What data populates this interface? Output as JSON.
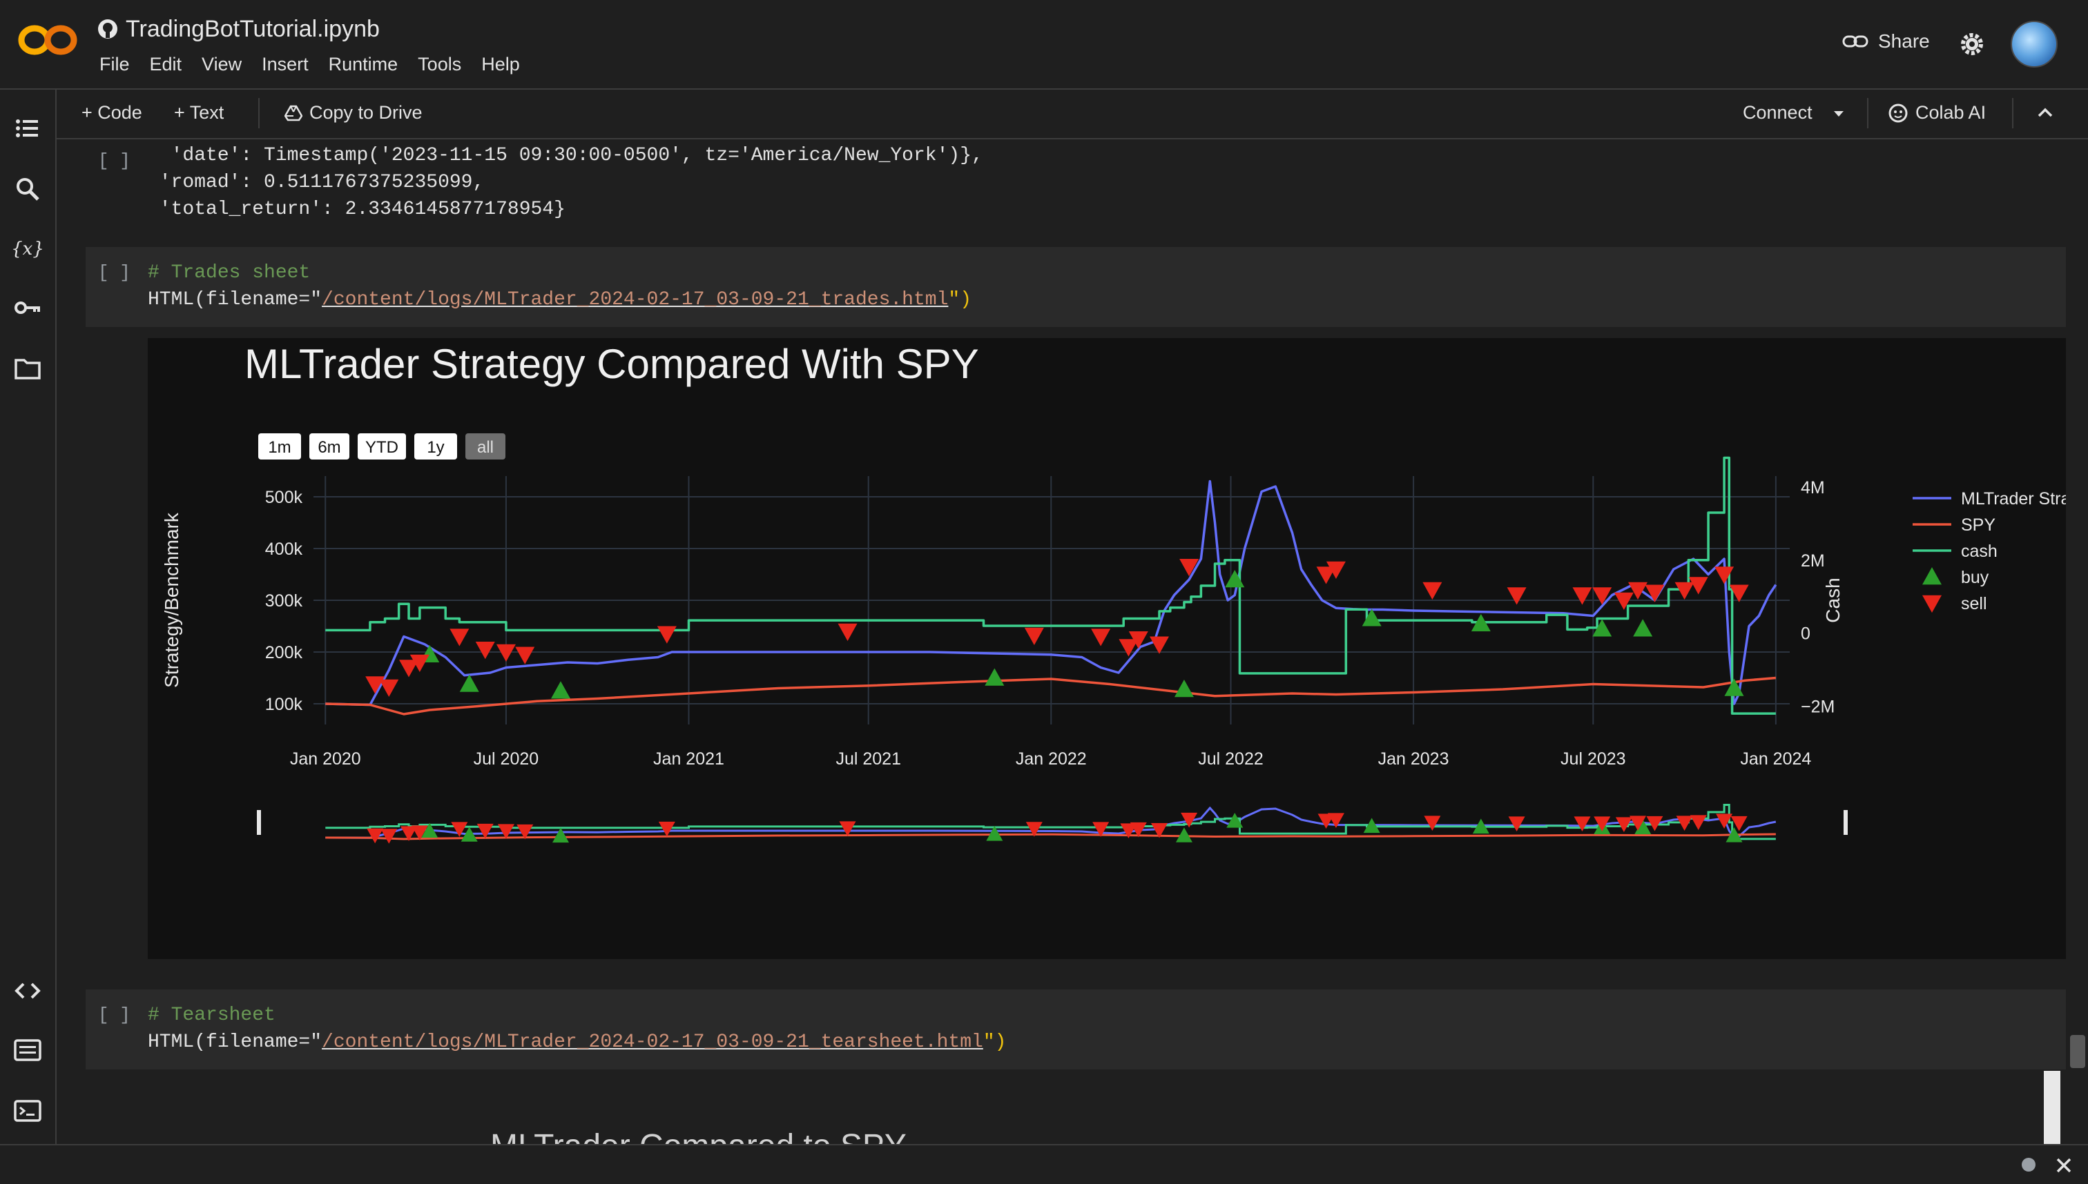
{
  "app": {
    "notebook_title": "TradingBotTutorial.ipynb",
    "menu": [
      "File",
      "Edit",
      "View",
      "Insert",
      "Runtime",
      "Tools",
      "Help"
    ],
    "share_label": "Share"
  },
  "toolbar": {
    "code_label": "+ Code",
    "text_label": "+ Text",
    "copy_label": "Copy to Drive",
    "connect_label": "Connect",
    "colab_ai_label": "Colab AI"
  },
  "cells": {
    "output_prev": {
      "bracket": "[ ]",
      "lines": [
        "  'date': Timestamp('2023-11-15 09:30:00-0500', tz='America/New_York')},",
        " 'romad': 0.5111767375235099,",
        " 'total_return': 2.3346145877178954}"
      ]
    },
    "trades_cell": {
      "bracket": "[ ]",
      "comment": "# Trades sheet",
      "code_prefix": "HTML(filename=\"",
      "code_path": "/content/logs/MLTrader_2024-02-17_03-09-21_trades.html",
      "code_suffix": "\")"
    },
    "tearsheet_cell": {
      "bracket": "[ ]",
      "comment": "# Tearsheet",
      "code_prefix": "HTML(filename=\"",
      "code_path": "/content/logs/MLTrader_2024-02-17_03-09-21_tearsheet.html",
      "code_suffix": "\")"
    },
    "partial_title": "MLTrader Compared to SPY"
  },
  "chart_data": {
    "type": "line",
    "title": "MLTrader Strategy Compared With SPY",
    "range_buttons": [
      "1m",
      "6m",
      "YTD",
      "1y",
      "all"
    ],
    "range_selected": "all",
    "ylabel": "Strategy/Benchmark",
    "y2label": "Cash",
    "x_ticks": [
      "Jan 2020",
      "Jul 2020",
      "Jan 2021",
      "Jul 2021",
      "Jan 2022",
      "Jul 2022",
      "Jan 2023",
      "Jul 2023",
      "Jan 2024"
    ],
    "y_ticks": [
      "100k",
      "200k",
      "300k",
      "400k",
      "500k"
    ],
    "y2_ticks": [
      "4M",
      "2M",
      "0",
      "−2M"
    ],
    "ylim": [
      60000,
      540000
    ],
    "y2lim": [
      -2500000,
      4300000
    ],
    "xlim": [
      "2019-12-20",
      "2024-01-15"
    ],
    "legend_position": "right",
    "colors": {
      "strategy": "#636efa",
      "spy": "#ef553b",
      "cash": "#3ecf8e",
      "buy": "#2ca02c",
      "sell": "#e8261b"
    },
    "series": [
      {
        "name": "MLTrader Strategy",
        "axis": "y",
        "x": [
          "2020-01-01",
          "2020-02-15",
          "2020-03-05",
          "2020-03-20",
          "2020-04-10",
          "2020-05-01",
          "2020-05-20",
          "2020-06-15",
          "2020-07-01",
          "2020-08-01",
          "2020-09-01",
          "2020-10-01",
          "2020-11-01",
          "2020-12-01",
          "2020-12-15",
          "2021-01-01",
          "2021-06-01",
          "2021-09-01",
          "2022-01-01",
          "2022-02-01",
          "2022-02-20",
          "2022-03-10",
          "2022-04-01",
          "2022-04-15",
          "2022-04-25",
          "2022-05-05",
          "2022-05-20",
          "2022-06-01",
          "2022-06-10",
          "2022-06-15",
          "2022-06-20",
          "2022-06-28",
          "2022-07-05",
          "2022-07-15",
          "2022-08-01",
          "2022-08-15",
          "2022-09-01",
          "2022-09-10",
          "2022-09-20",
          "2022-10-01",
          "2022-10-15",
          "2022-11-01",
          "2022-11-15",
          "2022-12-01",
          "2023-01-01",
          "2023-03-01",
          "2023-06-01",
          "2023-07-01",
          "2023-07-20",
          "2023-08-10",
          "2023-09-01",
          "2023-09-20",
          "2023-10-10",
          "2023-10-25",
          "2023-11-10",
          "2023-11-15",
          "2023-11-20",
          "2023-11-25",
          "2023-12-05",
          "2023-12-15",
          "2023-12-25",
          "2024-01-01"
        ],
        "values": [
          100000,
          98000,
          165000,
          230000,
          215000,
          190000,
          155000,
          160000,
          170000,
          175000,
          180000,
          178000,
          185000,
          190000,
          200000,
          200000,
          200000,
          200000,
          195000,
          190000,
          170000,
          160000,
          210000,
          220000,
          280000,
          310000,
          340000,
          380000,
          530000,
          450000,
          350000,
          300000,
          310000,
          400000,
          510000,
          520000,
          430000,
          360000,
          330000,
          300000,
          285000,
          283000,
          282000,
          282000,
          280000,
          278000,
          275000,
          270000,
          310000,
          330000,
          300000,
          360000,
          380000,
          350000,
          380000,
          200000,
          100000,
          120000,
          250000,
          270000,
          310000,
          330000
        ]
      },
      {
        "name": "SPY",
        "axis": "y",
        "x": [
          "2020-01-01",
          "2020-02-15",
          "2020-03-20",
          "2020-04-15",
          "2020-06-01",
          "2020-08-01",
          "2020-10-01",
          "2021-01-01",
          "2021-04-01",
          "2021-07-01",
          "2021-10-01",
          "2022-01-01",
          "2022-03-01",
          "2022-06-15",
          "2022-09-01",
          "2022-10-15",
          "2023-01-01",
          "2023-04-01",
          "2023-07-01",
          "2023-10-20",
          "2023-12-01",
          "2024-01-01"
        ],
        "values": [
          100000,
          98000,
          80000,
          88000,
          95000,
          105000,
          110000,
          120000,
          130000,
          135000,
          142000,
          148000,
          138000,
          115000,
          120000,
          118000,
          122000,
          128000,
          138000,
          132000,
          145000,
          150000
        ]
      },
      {
        "name": "cash",
        "axis": "y2",
        "step": true,
        "x": [
          "2020-01-01",
          "2020-02-15",
          "2020-03-01",
          "2020-03-15",
          "2020-03-25",
          "2020-04-05",
          "2020-05-01",
          "2020-05-15",
          "2020-06-15",
          "2020-07-01",
          "2020-12-15",
          "2021-01-01",
          "2021-06-01",
          "2021-10-25",
          "2022-01-01",
          "2022-03-15",
          "2022-04-20",
          "2022-05-01",
          "2022-05-15",
          "2022-05-22",
          "2022-06-01",
          "2022-06-15",
          "2022-06-25",
          "2022-07-10",
          "2022-10-20",
          "2022-10-25",
          "2022-11-15",
          "2023-01-01",
          "2023-03-01",
          "2023-05-15",
          "2023-06-05",
          "2023-06-25",
          "2023-07-05",
          "2023-08-05",
          "2023-09-15",
          "2023-10-05",
          "2023-10-25",
          "2023-11-10",
          "2023-11-15",
          "2023-11-18",
          "2024-01-01"
        ],
        "values": [
          80000,
          300000,
          400000,
          800000,
          400000,
          700000,
          400000,
          300000,
          300000,
          80000,
          80000,
          350000,
          350000,
          200000,
          200000,
          400000,
          600000,
          700000,
          850000,
          1000000,
          1300000,
          1900000,
          2000000,
          -1100000,
          -1100000,
          650000,
          350000,
          350000,
          300000,
          500000,
          100000,
          150000,
          400000,
          750000,
          1200000,
          2000000,
          3300000,
          4800000,
          1200000,
          -2200000,
          -2200000
        ]
      }
    ],
    "markers": {
      "buy": {
        "name": "buy",
        "x": [
          "2020-04-15",
          "2020-05-25",
          "2020-08-25",
          "2021-11-05",
          "2022-05-15",
          "2022-07-05",
          "2022-11-20",
          "2023-03-10",
          "2023-07-10",
          "2023-08-20",
          "2023-11-20"
        ],
        "values": [
          195000,
          138000,
          125000,
          150000,
          128000,
          340000,
          265000,
          255000,
          245000,
          245000,
          130000
        ]
      },
      "sell": {
        "name": "sell",
        "x": [
          "2020-02-20",
          "2020-03-05",
          "2020-03-25",
          "2020-04-05",
          "2020-05-15",
          "2020-06-10",
          "2020-07-01",
          "2020-07-20",
          "2020-12-10",
          "2021-06-10",
          "2021-12-15",
          "2022-02-20",
          "2022-03-20",
          "2022-03-30",
          "2022-04-20",
          "2022-05-20",
          "2022-10-05",
          "2022-10-15",
          "2023-01-20",
          "2023-04-15",
          "2023-06-20",
          "2023-07-10",
          "2023-08-01",
          "2023-08-15",
          "2023-09-01",
          "2023-10-01",
          "2023-10-15",
          "2023-11-10",
          "2023-11-25"
        ],
        "values": [
          138000,
          132000,
          170000,
          180000,
          230000,
          205000,
          200000,
          195000,
          235000,
          240000,
          232000,
          230000,
          210000,
          225000,
          215000,
          365000,
          350000,
          360000,
          320000,
          310000,
          310000,
          310000,
          300000,
          320000,
          315000,
          320000,
          330000,
          350000,
          315000
        ]
      }
    }
  }
}
